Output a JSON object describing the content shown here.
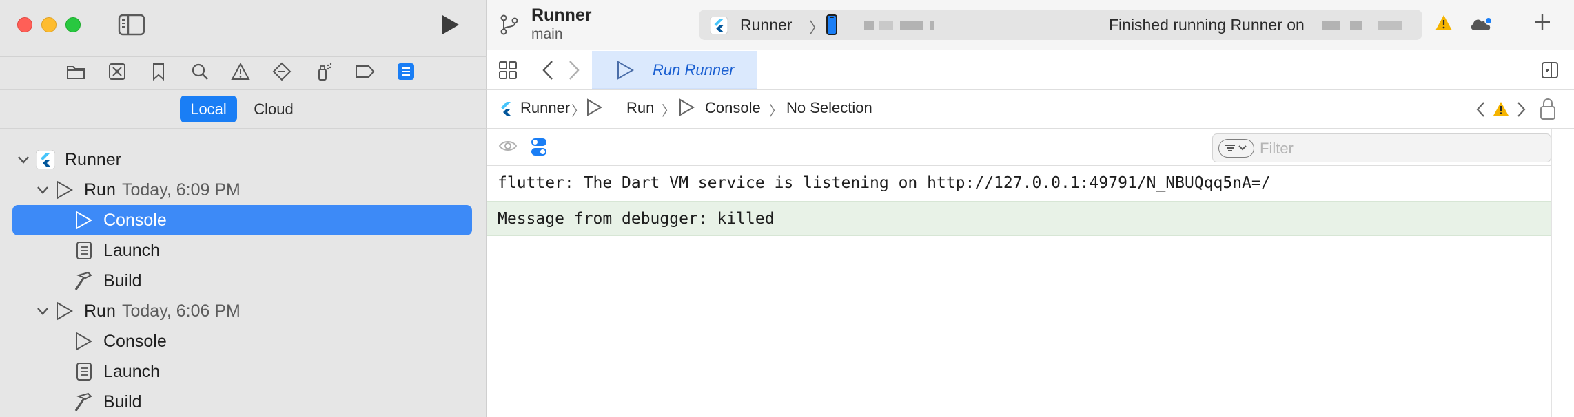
{
  "window": {
    "controls": [
      "close",
      "minimize",
      "zoom"
    ]
  },
  "sidebar": {
    "navigator_icons": [
      "folder-icon",
      "source-control-icon",
      "bookmark-icon",
      "search-icon",
      "issue-warning-icon",
      "test-diamond-icon",
      "debug-spray-icon",
      "breakpoint-tag-icon",
      "report-list-icon"
    ],
    "active_navigator": "report-list-icon",
    "scope": {
      "local": "Local",
      "cloud": "Cloud",
      "selected": "Local"
    },
    "tree": {
      "root": "Runner",
      "runs": [
        {
          "label": "Run",
          "time": "Today, 6:09 PM",
          "items": [
            {
              "label": "Console",
              "icon": "play-outline-icon",
              "selected": true
            },
            {
              "label": "Launch",
              "icon": "document-list-icon",
              "selected": false
            },
            {
              "label": "Build",
              "icon": "hammer-icon",
              "selected": false
            }
          ]
        },
        {
          "label": "Run",
          "time": "Today, 6:06 PM",
          "items": [
            {
              "label": "Console",
              "icon": "play-outline-icon",
              "selected": false
            },
            {
              "label": "Launch",
              "icon": "document-list-icon",
              "selected": false
            },
            {
              "label": "Build",
              "icon": "hammer-icon",
              "selected": false
            }
          ]
        }
      ]
    }
  },
  "toolbar": {
    "project": "Runner",
    "branch": "main",
    "scheme": "Runner",
    "scheme_separator": "〉",
    "status": "Finished running Runner on"
  },
  "tabs": {
    "active": "Run Runner"
  },
  "jumpbar": {
    "items": [
      "Runner",
      "Run",
      "Console",
      "No Selection"
    ],
    "separator": "〉"
  },
  "console": {
    "filter_placeholder": "Filter",
    "lines": [
      "flutter: The Dart VM service is listening on http://127.0.0.1:49791/N_NBUQqq5nA=/",
      "Message from debugger: killed"
    ]
  },
  "colors": {
    "accent": "#1a7ef5",
    "selection": "#3d8af7",
    "tab_active_bg": "#dbe9fd",
    "warning": "#f5b400",
    "console_highlight": "#e8f2e7"
  }
}
